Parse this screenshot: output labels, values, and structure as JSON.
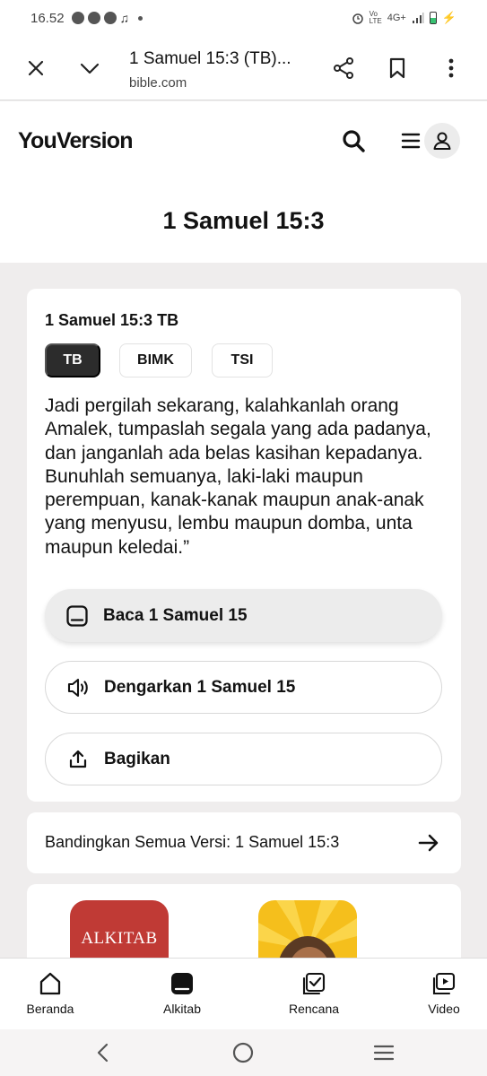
{
  "status_bar": {
    "time": "16.52",
    "network": "4G+"
  },
  "browser": {
    "page_title": "1 Samuel 15:3 (TB)...",
    "url": "bible.com"
  },
  "site": {
    "logo": "YouVersion",
    "heading": "1 Samuel 15:3"
  },
  "verse": {
    "reference": "1 Samuel 15:3 TB",
    "versions": [
      "TB",
      "BIMK",
      "TSI"
    ],
    "active_version": "TB",
    "lines": [
      "Jadi pergilah sekarang, kalahkanlah orang",
      "Amalek, tumpaslah segala yang ada padanya,",
      "dan janganlah ada belas kasihan kepadanya.",
      "Bunuhlah semuanya, laki-laki maupun",
      "perempuan, kanak-kanak maupun anak-anak",
      "yang menyusu, lembu maupun domba, unta",
      "maupun keledai.”"
    ]
  },
  "actions": {
    "read": "Baca 1 Samuel 15",
    "listen": "Dengarkan 1 Samuel 15",
    "share": "Bagikan"
  },
  "compare": {
    "label": "Bandingkan Semua Versi: 1 Samuel 15:3"
  },
  "apps": {
    "bible_app_label": "ALKITAB"
  },
  "bottom_nav": {
    "home": "Beranda",
    "bible": "Alkitab",
    "plans": "Rencana",
    "video": "Video"
  },
  "colors": {
    "dark": "#2c2c2c",
    "background": "#efeded",
    "bible_app_red": "#c03a35",
    "kids_app_yellow": "#f5bf1c"
  }
}
